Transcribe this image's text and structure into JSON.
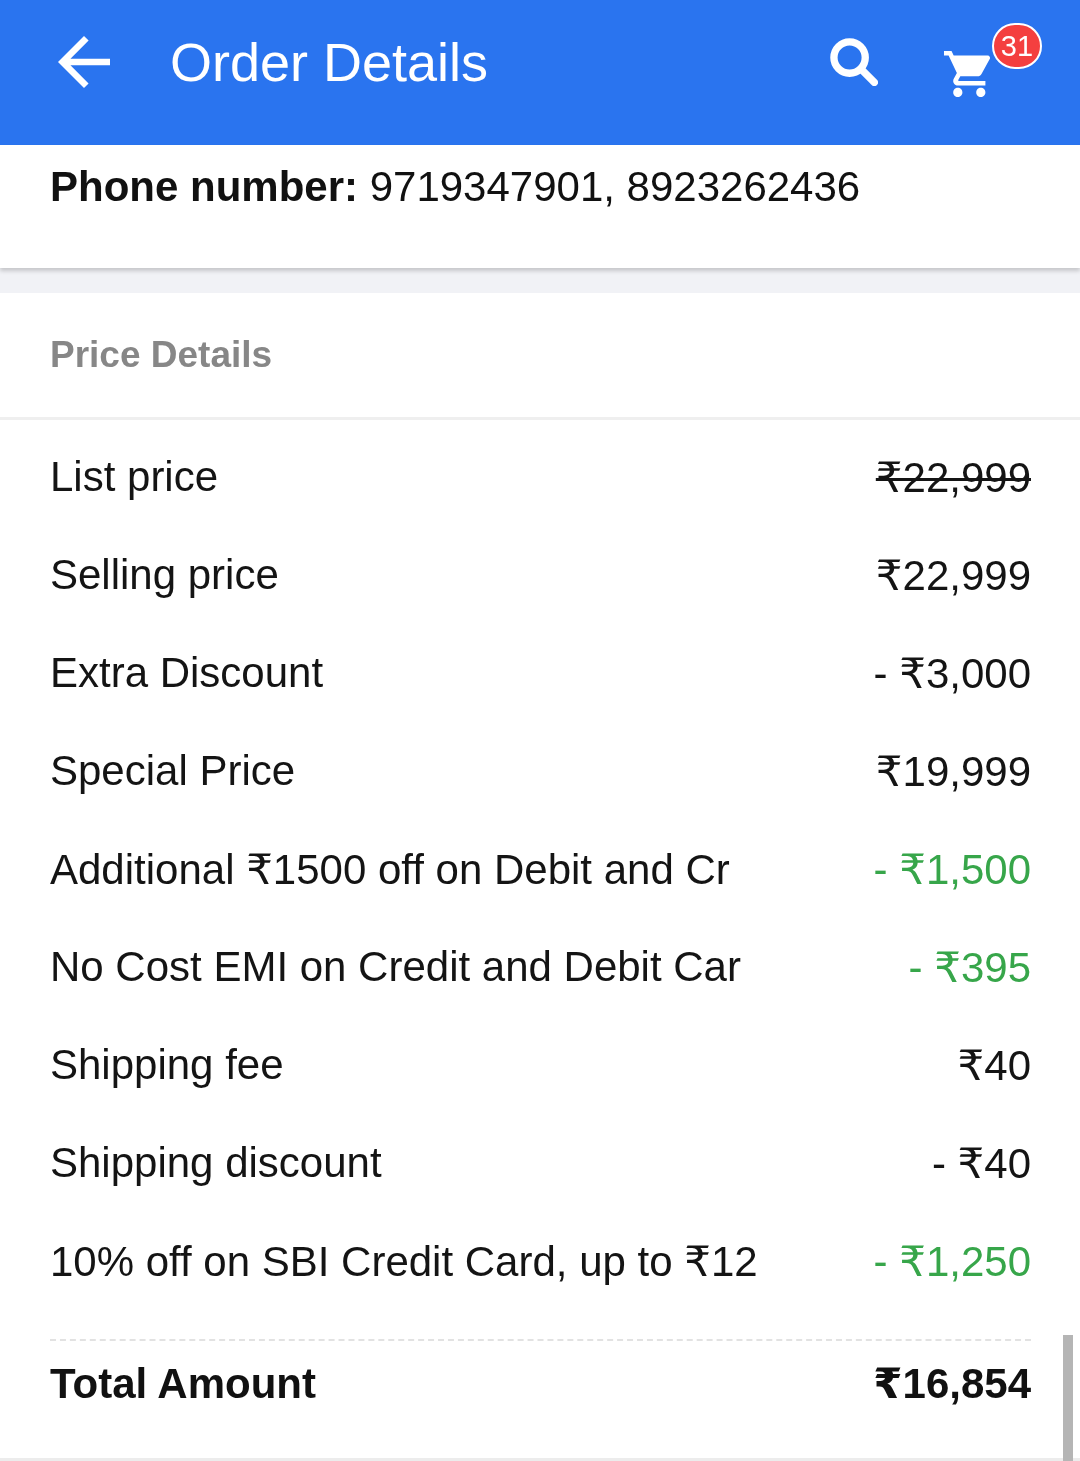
{
  "header": {
    "title": "Order Details",
    "cart_badge": "31"
  },
  "contact": {
    "phone": "**Phone number:** 9719347901, 8923262436"
  },
  "price_details": {
    "title": "Price Details",
    "rows": [
      {
        "label": "List price",
        "value": "₹22,999",
        "kind": "struck"
      },
      {
        "label": "Selling price",
        "value": "₹22,999",
        "kind": "plain"
      },
      {
        "label": "Extra Discount",
        "value": "- ₹3,000",
        "kind": "plain"
      },
      {
        "label": "Special Price",
        "value": "₹19,999",
        "kind": "plain"
      },
      {
        "label": "Additional ₹1500 off on Debit and Cr",
        "value": "- ₹1,500",
        "kind": "saving"
      },
      {
        "label": "No Cost EMI on Credit and Debit Car",
        "value": "- ₹395",
        "kind": "saving"
      },
      {
        "label": "Shipping fee",
        "value": "₹40",
        "kind": "plain"
      },
      {
        "label": "Shipping discount",
        "value": "- ₹40",
        "kind": "plain"
      },
      {
        "label": "10% off on SBI Credit Card, up to ₹12",
        "value": "- ₹1,250",
        "kind": "saving"
      }
    ],
    "total": {
      "label": "Total Amount",
      "value": "₹16,854"
    }
  }
}
